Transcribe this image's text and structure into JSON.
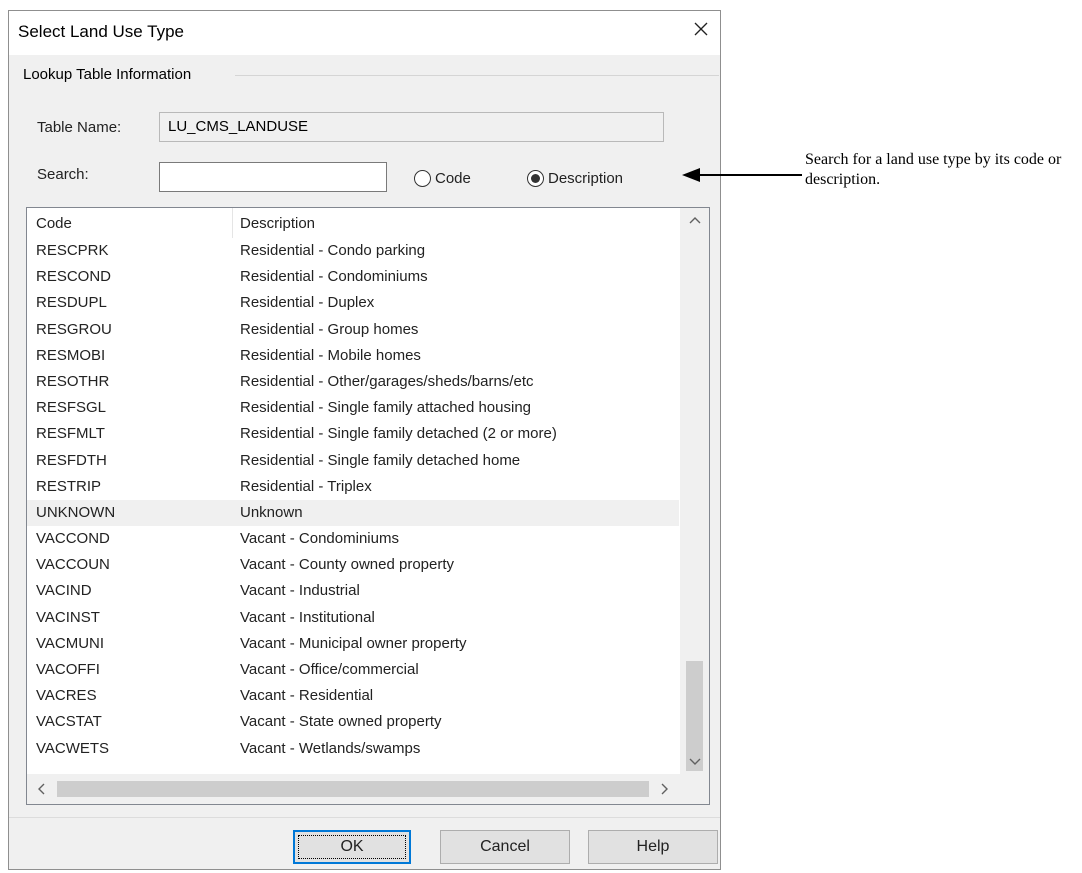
{
  "dialog": {
    "title": "Select Land Use Type",
    "group_label": "Lookup Table Information",
    "table_name_label": "Table Name:",
    "table_name_value": "LU_CMS_LANDUSE",
    "search_label": "Search:",
    "search_value": "",
    "search_placeholder": "",
    "radio_code_label": "Code",
    "radio_description_label": "Description",
    "selected_radio": "Description"
  },
  "list": {
    "headers": {
      "code": "Code",
      "description": "Description"
    },
    "rows": [
      {
        "code": "RESCPRK",
        "description": "Residential - Condo parking"
      },
      {
        "code": "RESCOND",
        "description": "Residential - Condominiums"
      },
      {
        "code": "RESDUPL",
        "description": "Residential - Duplex"
      },
      {
        "code": "RESGROU",
        "description": "Residential - Group homes"
      },
      {
        "code": "RESMOBI",
        "description": "Residential - Mobile homes"
      },
      {
        "code": "RESOTHR",
        "description": "Residential - Other/garages/sheds/barns/etc"
      },
      {
        "code": "RESFSGL",
        "description": "Residential - Single family attached housing"
      },
      {
        "code": "RESFMLT",
        "description": "Residential - Single family detached (2 or more)"
      },
      {
        "code": "RESFDTH",
        "description": "Residential - Single family detached home"
      },
      {
        "code": "RESTRIP",
        "description": "Residential - Triplex"
      },
      {
        "code": "UNKNOWN",
        "description": "Unknown"
      },
      {
        "code": "VACCOND",
        "description": "Vacant - Condominiums"
      },
      {
        "code": "VACCOUN",
        "description": "Vacant - County owned property"
      },
      {
        "code": "VACIND",
        "description": "Vacant - Industrial"
      },
      {
        "code": "VACINST",
        "description": "Vacant - Institutional"
      },
      {
        "code": "VACMUNI",
        "description": "Vacant - Municipal owner property"
      },
      {
        "code": "VACOFFI",
        "description": "Vacant - Office/commercial"
      },
      {
        "code": "VACRES",
        "description": "Vacant - Residential"
      },
      {
        "code": "VACSTAT",
        "description": "Vacant - State owned property"
      },
      {
        "code": "VACWETS",
        "description": "Vacant - Wetlands/swamps"
      }
    ],
    "highlighted_code": "UNKNOWN"
  },
  "buttons": {
    "ok": "OK",
    "cancel": "Cancel",
    "help": "Help"
  },
  "annotation": {
    "text": "Search for a land use type by its code or description."
  },
  "icons": {
    "close": "close-icon",
    "scroll_up": "chevron-up-icon",
    "scroll_down": "chevron-down-icon",
    "scroll_left": "chevron-left-icon",
    "scroll_right": "chevron-right-icon",
    "annotation_arrow": "arrow-left-icon"
  },
  "colors": {
    "dialog_bg": "#f0f0f0",
    "accent": "#0078d7",
    "highlight_row": "#f0f0f0"
  }
}
